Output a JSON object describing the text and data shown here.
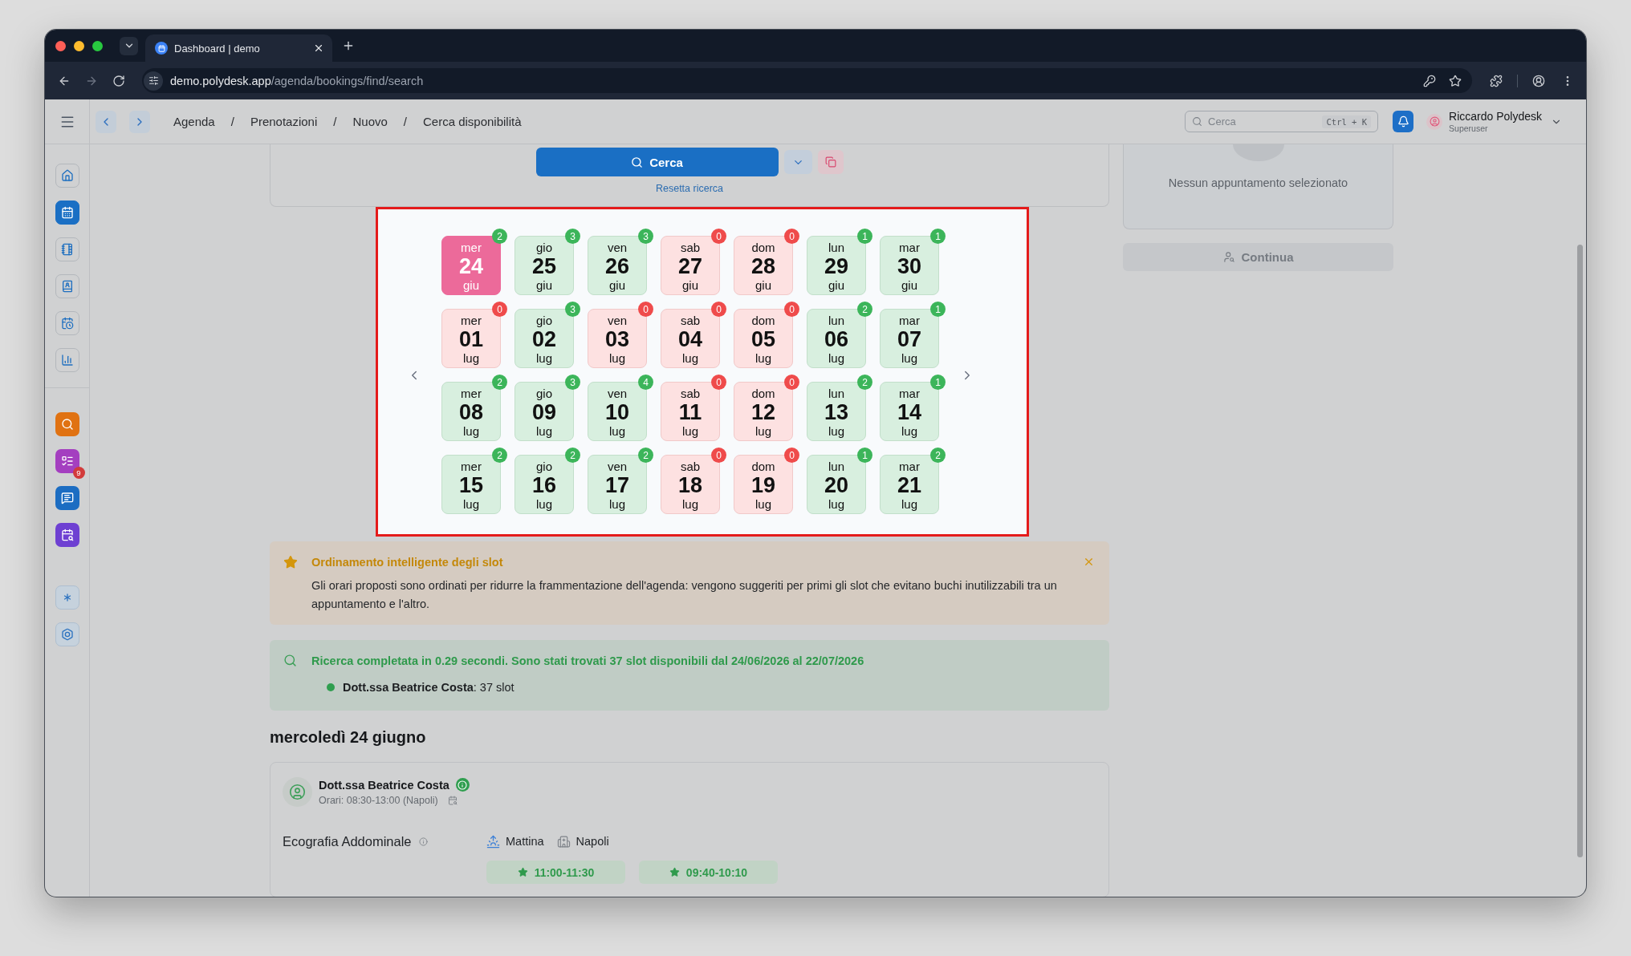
{
  "browser": {
    "tab_title": "Dashboard | demo",
    "url_host": "demo.polydesk.app",
    "url_path": "/agenda/bookings/find/search"
  },
  "header": {
    "breadcrumbs": [
      {
        "label": "Agenda"
      },
      {
        "separator": "/",
        "label": "Prenotazioni"
      },
      {
        "separator": "/",
        "label": "Nuovo"
      },
      {
        "separator": "/",
        "label": "Cerca disponibilità"
      }
    ],
    "search": {
      "placeholder": "Cerca",
      "shortcut": "Ctrl + K"
    },
    "user": {
      "name": "Riccardo Polydesk",
      "role": "Superuser"
    }
  },
  "sidebar": {
    "nav_items": [
      {
        "selected": false
      },
      {
        "selected": true
      },
      {
        "selected": false
      },
      {
        "selected": false
      },
      {
        "selected": false
      },
      {
        "selected": false
      }
    ],
    "shortcuts": [
      {
        "color": "#e07212"
      },
      {
        "color": "#a43fc0",
        "badge": "9"
      },
      {
        "color": "#1c6dc2"
      },
      {
        "color": "#6e40d2"
      }
    ]
  },
  "search_card": {
    "search_button": "Cerca",
    "reset_link": "Resetta ricerca"
  },
  "calendar": {
    "days": [
      {
        "weekday": "mer",
        "day": "24",
        "month": "giu",
        "count": "2",
        "available": true,
        "selected": true
      },
      {
        "weekday": "gio",
        "day": "25",
        "month": "giu",
        "count": "3",
        "available": true,
        "selected": false
      },
      {
        "weekday": "ven",
        "day": "26",
        "month": "giu",
        "count": "3",
        "available": true,
        "selected": false
      },
      {
        "weekday": "sab",
        "day": "27",
        "month": "giu",
        "count": "0",
        "available": false,
        "selected": false
      },
      {
        "weekday": "dom",
        "day": "28",
        "month": "giu",
        "count": "0",
        "available": false,
        "selected": false
      },
      {
        "weekday": "lun",
        "day": "29",
        "month": "giu",
        "count": "1",
        "available": true,
        "selected": false
      },
      {
        "weekday": "mar",
        "day": "30",
        "month": "giu",
        "count": "1",
        "available": true,
        "selected": false
      },
      {
        "weekday": "mer",
        "day": "01",
        "month": "lug",
        "count": "0",
        "available": false,
        "selected": false
      },
      {
        "weekday": "gio",
        "day": "02",
        "month": "lug",
        "count": "3",
        "available": true,
        "selected": false
      },
      {
        "weekday": "ven",
        "day": "03",
        "month": "lug",
        "count": "0",
        "available": false,
        "selected": false
      },
      {
        "weekday": "sab",
        "day": "04",
        "month": "lug",
        "count": "0",
        "available": false,
        "selected": false
      },
      {
        "weekday": "dom",
        "day": "05",
        "month": "lug",
        "count": "0",
        "available": false,
        "selected": false
      },
      {
        "weekday": "lun",
        "day": "06",
        "month": "lug",
        "count": "2",
        "available": true,
        "selected": false
      },
      {
        "weekday": "mar",
        "day": "07",
        "month": "lug",
        "count": "1",
        "available": true,
        "selected": false
      },
      {
        "weekday": "mer",
        "day": "08",
        "month": "lug",
        "count": "2",
        "available": true,
        "selected": false
      },
      {
        "weekday": "gio",
        "day": "09",
        "month": "lug",
        "count": "3",
        "available": true,
        "selected": false
      },
      {
        "weekday": "ven",
        "day": "10",
        "month": "lug",
        "count": "4",
        "available": true,
        "selected": false
      },
      {
        "weekday": "sab",
        "day": "11",
        "month": "lug",
        "count": "0",
        "available": false,
        "selected": false
      },
      {
        "weekday": "dom",
        "day": "12",
        "month": "lug",
        "count": "0",
        "available": false,
        "selected": false
      },
      {
        "weekday": "lun",
        "day": "13",
        "month": "lug",
        "count": "2",
        "available": true,
        "selected": false
      },
      {
        "weekday": "mar",
        "day": "14",
        "month": "lug",
        "count": "1",
        "available": true,
        "selected": false
      },
      {
        "weekday": "mer",
        "day": "15",
        "month": "lug",
        "count": "2",
        "available": true,
        "selected": false
      },
      {
        "weekday": "gio",
        "day": "16",
        "month": "lug",
        "count": "2",
        "available": true,
        "selected": false
      },
      {
        "weekday": "ven",
        "day": "17",
        "month": "lug",
        "count": "2",
        "available": true,
        "selected": false
      },
      {
        "weekday": "sab",
        "day": "18",
        "month": "lug",
        "count": "0",
        "available": false,
        "selected": false
      },
      {
        "weekday": "dom",
        "day": "19",
        "month": "lug",
        "count": "0",
        "available": false,
        "selected": false
      },
      {
        "weekday": "lun",
        "day": "20",
        "month": "lug",
        "count": "1",
        "available": true,
        "selected": false
      },
      {
        "weekday": "mar",
        "day": "21",
        "month": "lug",
        "count": "2",
        "available": true,
        "selected": false
      }
    ]
  },
  "notice": {
    "title": "Ordinamento intelligente degli slot",
    "text": "Gli orari proposti sono ordinati per ridurre la frammentazione dell'agenda: vengono suggeriti per primi gli slot che evitano buchi inutilizzabili tra un appuntamento e l'altro."
  },
  "search_result": {
    "message": "Ricerca completata in 0.29 secondi. Sono stati trovati 37 slot disponibili dal 24/06/2026 al 22/07/2026",
    "providers": [
      "**Dott.ssa Beatrice Costa**: 37 slot"
    ]
  },
  "day_heading": "mercoledì 24 giugno",
  "day_card": {
    "provider": {
      "name": "Dott.ssa Beatrice Costa",
      "hours": "Orari: 08:30-13:00 (Napoli)"
    },
    "services": [
      {
        "name": "Ecografia Addominale",
        "period": "Mattina",
        "location": "Napoli",
        "slots": [
          {
            "time": "11:00-11:30",
            "recommended": true
          },
          {
            "time": "09:40-10:10",
            "recommended": true
          }
        ]
      }
    ]
  },
  "summary": {
    "empty_text": "Nessun appuntamento selezionato",
    "continue_button": {
      "label": "Continua",
      "disabled": true
    }
  }
}
